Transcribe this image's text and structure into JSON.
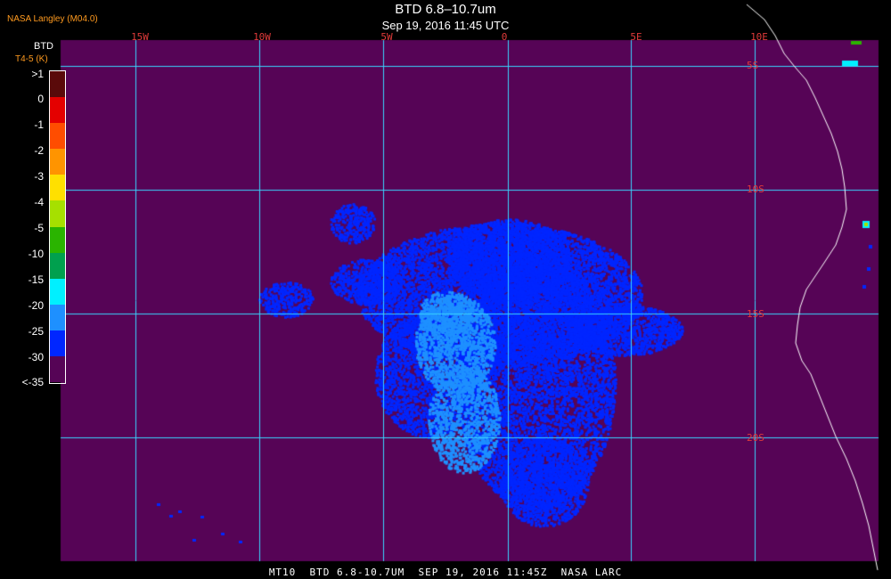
{
  "header": {
    "title": "BTD 6.8–10.7um",
    "subtitle": "Sep 19, 2016 11:45 UTC",
    "producer": "NASA Langley (M04.0)"
  },
  "footer": "MT10  BTD 6.8-10.7UM  SEP 19, 2016 11:45Z  NASA LARC",
  "legend": {
    "title_line1": "BTD",
    "title_line2": "T4-5 (K)",
    "ticks": [
      ">1",
      "0",
      "-1",
      "-2",
      "-3",
      "-4",
      "-5",
      "-10",
      "-15",
      "-20",
      "-25",
      "-30",
      "<-35"
    ],
    "colors": [
      "#5a0a0a",
      "#e40000",
      "#ff4d00",
      "#ff9400",
      "#ffe000",
      "#a6e000",
      "#2ab400",
      "#00a04e",
      "#00f0ff",
      "#1e90ff",
      "#0026ff",
      "#560456"
    ]
  },
  "map": {
    "lon_labels": [
      "15W",
      "10W",
      "5W",
      "0",
      "5E",
      "10E"
    ],
    "lat_labels": [
      "5S",
      "10S",
      "15S",
      "20S"
    ],
    "background_color": "#560456",
    "grid_color": "#39d4ff",
    "coast_color": "#ffffff"
  }
}
